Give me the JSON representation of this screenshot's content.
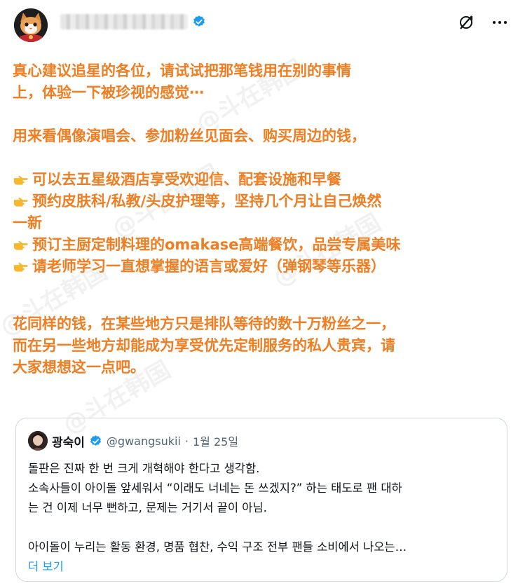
{
  "colors": {
    "post_text": "#ef7d21",
    "verified": "#1d9bf0",
    "link": "#1d9bf0",
    "muted": "#536471"
  },
  "icons": {
    "verified": "verified-badge-icon",
    "grok": "grok-icon",
    "more": "more-dots-icon",
    "pointing": "backhand-index-pointing-right-icon"
  },
  "header": {
    "display_name_blurred": true
  },
  "post": {
    "lines": [
      "真心建议追星的各位，请试试把那笔钱用在别的事情",
      "上，体验一下被珍视的感觉⋯",
      "用来看偶像演唱会、参加粉丝见面会、购买周边的钱，",
      "可以去五星级酒店享受欢迎信、配套设施和早餐",
      "预约皮肤科/私教/头皮护理等，坚持几个月让自己焕然",
      "一新",
      "预订主厨定制料理的omakase高端餐饮，品尝专属美味",
      "请老师学习一直想掌握的语言或爱好（弹钢琴等乐器）",
      "花同样的钱，在某些地方只是排队等待的数十万粉丝之一，",
      "而在另一些地方却能成为享受优先定制服务的私人贵宾，请",
      "大家想想这一点吧。"
    ]
  },
  "quote": {
    "name": "광숙이",
    "handle": "@gwangsukii",
    "separator": "·",
    "date": "1월 25일",
    "paragraphs": [
      "돌판은 진짜 한 번 크게 개혁해야 한다고 생각함.",
      "소속사들이 아이돌 앞세워서 “이래도 너네는 돈 쓰겠지?” 하는 태도로 팬 대하",
      "는 건 이제 너무 뻔하고, 문제는 거기서 끝이 아님.",
      "아이돌이 누리는 활동 환경, 명품 협찬, 수익 구조 전부 팬들 소비에서 나오는…"
    ],
    "show_more": "더 보기"
  }
}
